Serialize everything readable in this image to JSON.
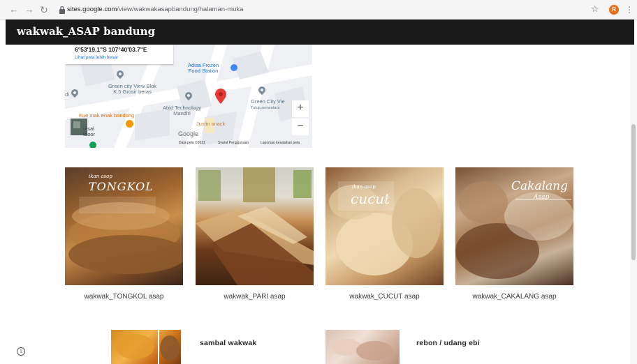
{
  "browser": {
    "url_host": "sites.google.com",
    "url_path": "/view/wakwakasapbandung/halaman-muka",
    "profile_initial": "R"
  },
  "site": {
    "title": "wakwak_ASAP bandung"
  },
  "map": {
    "coordinates": "6°53'19.1\"S 107°40'03.7\"E",
    "link": "Lihat peta lebih besar",
    "labels": {
      "adisa": "Adisa Frozen\nFood Station",
      "green_city": "Green city View Blok\nK.5 Grosir beras",
      "abid": "Abid Technology\nMandiri",
      "green_city_right": "Green City Vie",
      "green_city_right_sub": "Tutup sementara",
      "kue": "Kue mak enak bandung",
      "justin": "Justin snack",
      "futsal": "utsal\ntdoor",
      "left_edge": "di"
    },
    "zoom_in": "+",
    "zoom_out": "−",
    "google": "Google",
    "footer": [
      "Data peta ©2021",
      "Syarat Penggunaan",
      "Laporkan kesalahan peta"
    ]
  },
  "gallery": [
    {
      "caption": "wakwak_TONGKOL asap",
      "overlay_small": "ikan asap",
      "overlay": "TONGKOL"
    },
    {
      "caption": "wakwak_PARI asap"
    },
    {
      "caption": "wakwak_CUCUT asap",
      "overlay_small": "ikan asap",
      "overlay": "cucut"
    },
    {
      "caption": "wakwak_CAKALANG asap",
      "overlay": "Cakalang",
      "overlay_small": "Asap"
    }
  ],
  "lower": [
    {
      "label": "sambal wakwak"
    },
    {
      "label": "rebon / udang ebi"
    }
  ],
  "info_icon": "i",
  "colors": {
    "header_bg": "#1a1a1a",
    "map_pin": "#e53935",
    "link": "#1a73e8",
    "profile": "#e8711c"
  }
}
